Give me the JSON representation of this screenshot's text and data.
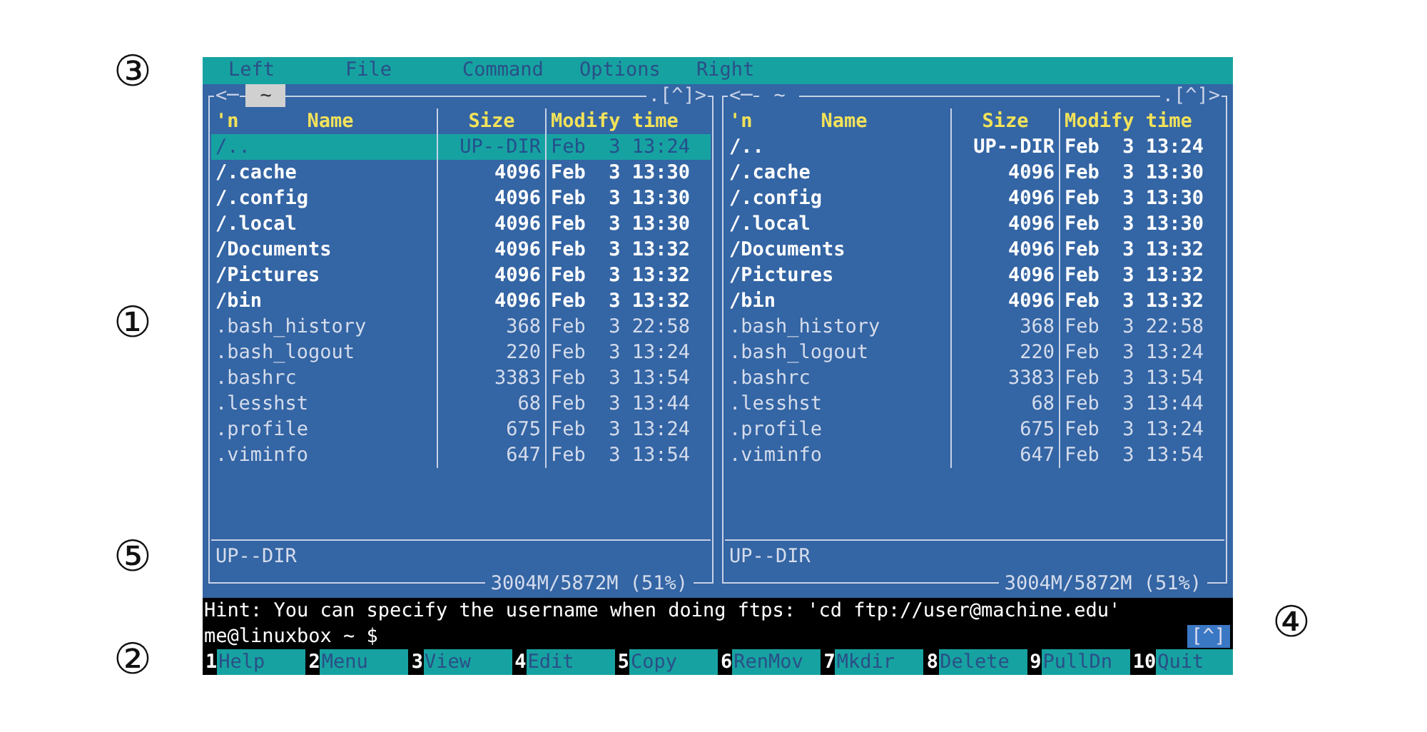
{
  "menu_bar": [
    "Left",
    "File",
    "Command",
    "Options",
    "Right"
  ],
  "panels": [
    {
      "active": true,
      "nav_left": "<─",
      "path": "~",
      "nav_right": ".[^]>",
      "columns": [
        "'n",
        "Name",
        "Size",
        "Modify time"
      ],
      "rows": [
        {
          "kind": "updir",
          "selected": true,
          "name": "/..",
          "size": "UP--DIR",
          "modified": "Feb  3 13:24"
        },
        {
          "kind": "dir",
          "selected": false,
          "name": "/.cache",
          "size": "4096",
          "modified": "Feb  3 13:30"
        },
        {
          "kind": "dir",
          "selected": false,
          "name": "/.config",
          "size": "4096",
          "modified": "Feb  3 13:30"
        },
        {
          "kind": "dir",
          "selected": false,
          "name": "/.local",
          "size": "4096",
          "modified": "Feb  3 13:30"
        },
        {
          "kind": "dir",
          "selected": false,
          "name": "/Documents",
          "size": "4096",
          "modified": "Feb  3 13:32"
        },
        {
          "kind": "dir",
          "selected": false,
          "name": "/Pictures",
          "size": "4096",
          "modified": "Feb  3 13:32"
        },
        {
          "kind": "dir",
          "selected": false,
          "name": "/bin",
          "size": "4096",
          "modified": "Feb  3 13:32"
        },
        {
          "kind": "file",
          "selected": false,
          "name": ".bash_history",
          "size": "368",
          "modified": "Feb  3 22:58"
        },
        {
          "kind": "file",
          "selected": false,
          "name": ".bash_logout",
          "size": "220",
          "modified": "Feb  3 13:24"
        },
        {
          "kind": "file",
          "selected": false,
          "name": ".bashrc",
          "size": "3383",
          "modified": "Feb  3 13:54"
        },
        {
          "kind": "file",
          "selected": false,
          "name": ".lesshst",
          "size": "68",
          "modified": "Feb  3 13:44"
        },
        {
          "kind": "file",
          "selected": false,
          "name": ".profile",
          "size": "675",
          "modified": "Feb  3 13:24"
        },
        {
          "kind": "file",
          "selected": false,
          "name": ".viminfo",
          "size": "647",
          "modified": "Feb  3 13:54"
        }
      ],
      "status": "UP--DIR",
      "disk": "3004M/5872M (51%)"
    },
    {
      "active": false,
      "nav_left": "<─",
      "path": "~",
      "nav_right": ".[^]>",
      "columns": [
        "'n",
        "Name",
        "Size",
        "Modify time"
      ],
      "rows": [
        {
          "kind": "updir",
          "selected": false,
          "name": "/..",
          "size": "UP--DIR",
          "modified": "Feb  3 13:24"
        },
        {
          "kind": "dir",
          "selected": false,
          "name": "/.cache",
          "size": "4096",
          "modified": "Feb  3 13:30"
        },
        {
          "kind": "dir",
          "selected": false,
          "name": "/.config",
          "size": "4096",
          "modified": "Feb  3 13:30"
        },
        {
          "kind": "dir",
          "selected": false,
          "name": "/.local",
          "size": "4096",
          "modified": "Feb  3 13:30"
        },
        {
          "kind": "dir",
          "selected": false,
          "name": "/Documents",
          "size": "4096",
          "modified": "Feb  3 13:32"
        },
        {
          "kind": "dir",
          "selected": false,
          "name": "/Pictures",
          "size": "4096",
          "modified": "Feb  3 13:32"
        },
        {
          "kind": "dir",
          "selected": false,
          "name": "/bin",
          "size": "4096",
          "modified": "Feb  3 13:32"
        },
        {
          "kind": "file",
          "selected": false,
          "name": ".bash_history",
          "size": "368",
          "modified": "Feb  3 22:58"
        },
        {
          "kind": "file",
          "selected": false,
          "name": ".bash_logout",
          "size": "220",
          "modified": "Feb  3 13:24"
        },
        {
          "kind": "file",
          "selected": false,
          "name": ".bashrc",
          "size": "3383",
          "modified": "Feb  3 13:54"
        },
        {
          "kind": "file",
          "selected": false,
          "name": ".lesshst",
          "size": "68",
          "modified": "Feb  3 13:44"
        },
        {
          "kind": "file",
          "selected": false,
          "name": ".profile",
          "size": "675",
          "modified": "Feb  3 13:24"
        },
        {
          "kind": "file",
          "selected": false,
          "name": ".viminfo",
          "size": "647",
          "modified": "Feb  3 13:54"
        }
      ],
      "status": "UP--DIR",
      "disk": "3004M/5872M (51%)"
    }
  ],
  "hint": "Hint: You can specify the username when doing ftps: 'cd ftp://user@machine.edu'",
  "prompt": "me@linuxbox ~ $",
  "prompt_button": "[^]",
  "function_keys": [
    {
      "key": "1",
      "label": "Help"
    },
    {
      "key": "2",
      "label": "Menu"
    },
    {
      "key": "3",
      "label": "View"
    },
    {
      "key": "4",
      "label": "Edit"
    },
    {
      "key": "5",
      "label": "Copy"
    },
    {
      "key": "6",
      "label": "RenMov"
    },
    {
      "key": "7",
      "label": "Mkdir"
    },
    {
      "key": "8",
      "label": "Delete"
    },
    {
      "key": "9",
      "label": "PullDn"
    },
    {
      "key": "10",
      "label": "Quit"
    }
  ],
  "callouts": [
    "③",
    "①",
    "⑤",
    "②",
    "④"
  ]
}
